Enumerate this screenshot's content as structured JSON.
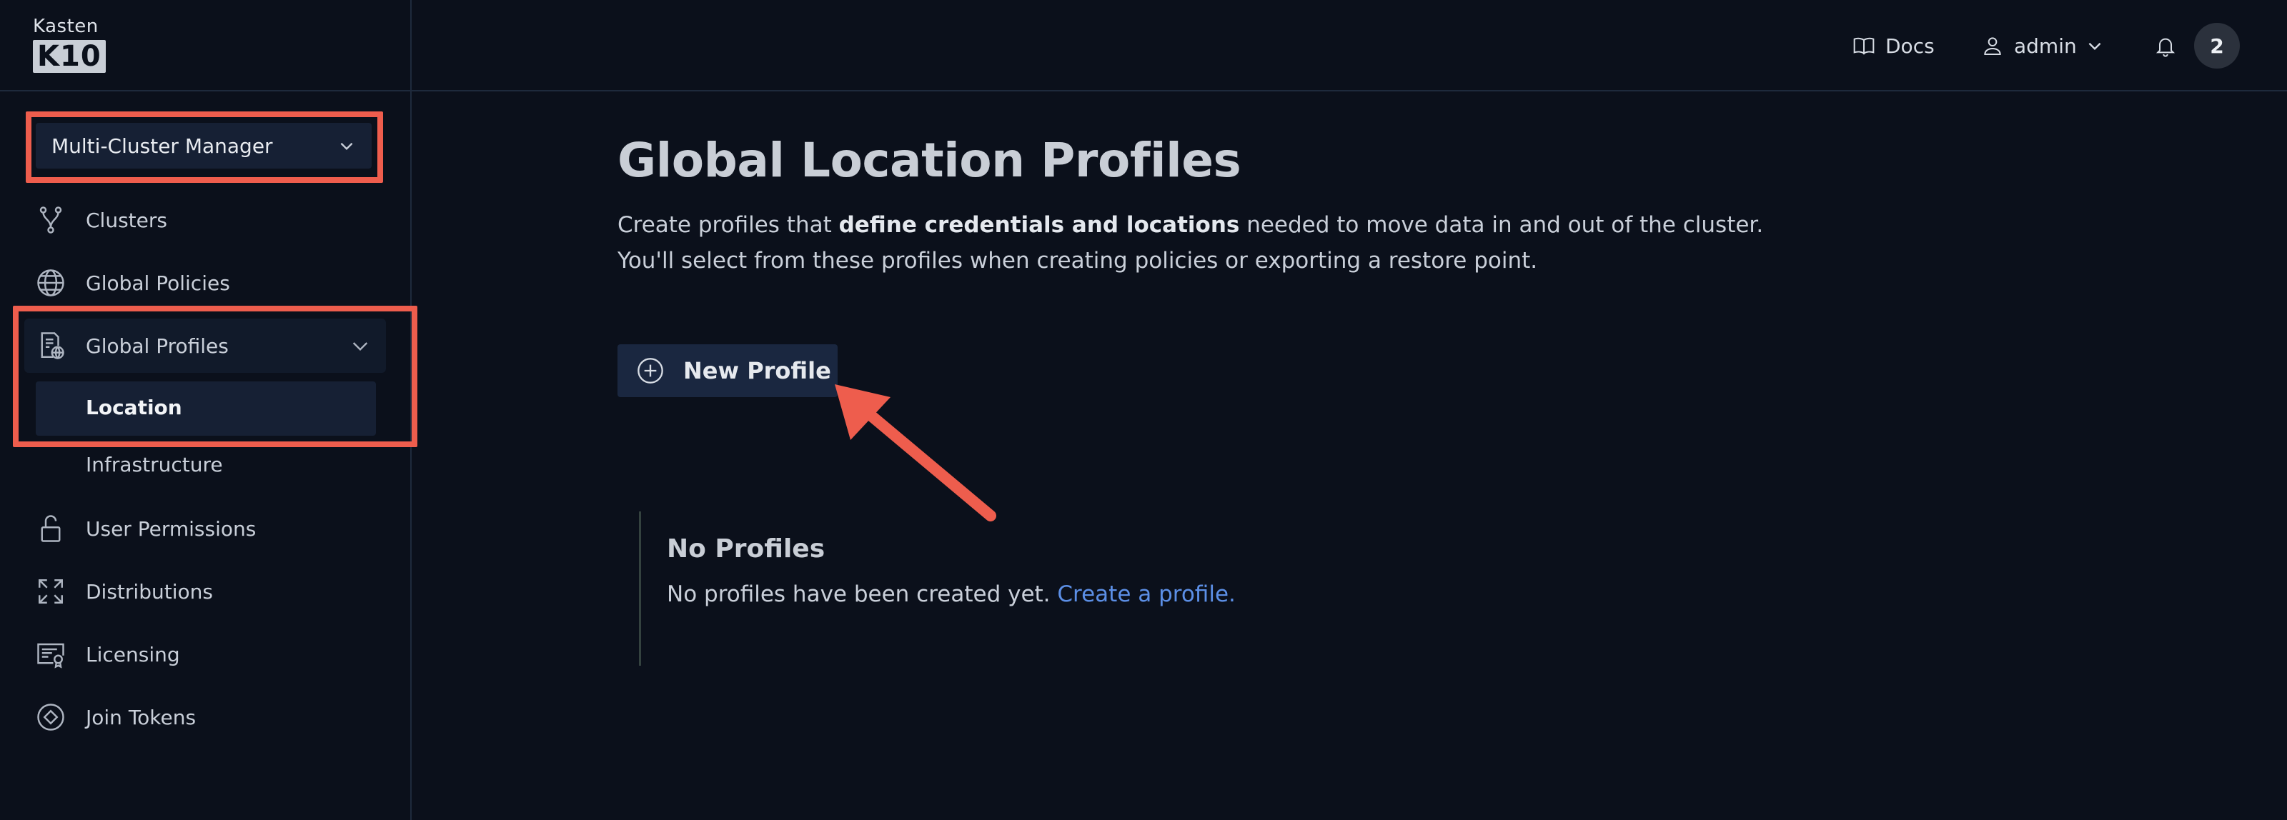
{
  "logo": {
    "word": "Kasten",
    "badge": "K10"
  },
  "sidebar": {
    "cluster_select": {
      "value": "Multi-Cluster Manager"
    },
    "items": [
      {
        "label": "Clusters",
        "icon": "fork-icon"
      },
      {
        "label": "Global Policies",
        "icon": "globe-icon"
      },
      {
        "label": "Global Profiles",
        "icon": "document-globe-icon"
      },
      {
        "label": "Location"
      },
      {
        "label": "Infrastructure"
      },
      {
        "label": "User Permissions",
        "icon": "unlock-icon"
      },
      {
        "label": "Distributions",
        "icon": "expand-icon"
      },
      {
        "label": "Licensing",
        "icon": "certificate-icon"
      },
      {
        "label": "Join Tokens",
        "icon": "token-icon"
      }
    ]
  },
  "header": {
    "docs_label": "Docs",
    "user_label": "admin",
    "notification_count": "2"
  },
  "main": {
    "title": "Global Location Profiles",
    "description_pre": "Create profiles that ",
    "description_bold": "define credentials and locations",
    "description_post": " needed to move data in and out of the cluster. You'll select from these profiles when creating policies or exporting a restore point.",
    "new_profile_label": "New Profile",
    "empty": {
      "title": "No Profiles",
      "text": "No profiles have been created yet. ",
      "link": "Create a profile."
    }
  },
  "colors": {
    "background": "#0b101b",
    "highlight": "#ee5d4d",
    "link": "#5c8fe6",
    "button": "#1a2740"
  }
}
